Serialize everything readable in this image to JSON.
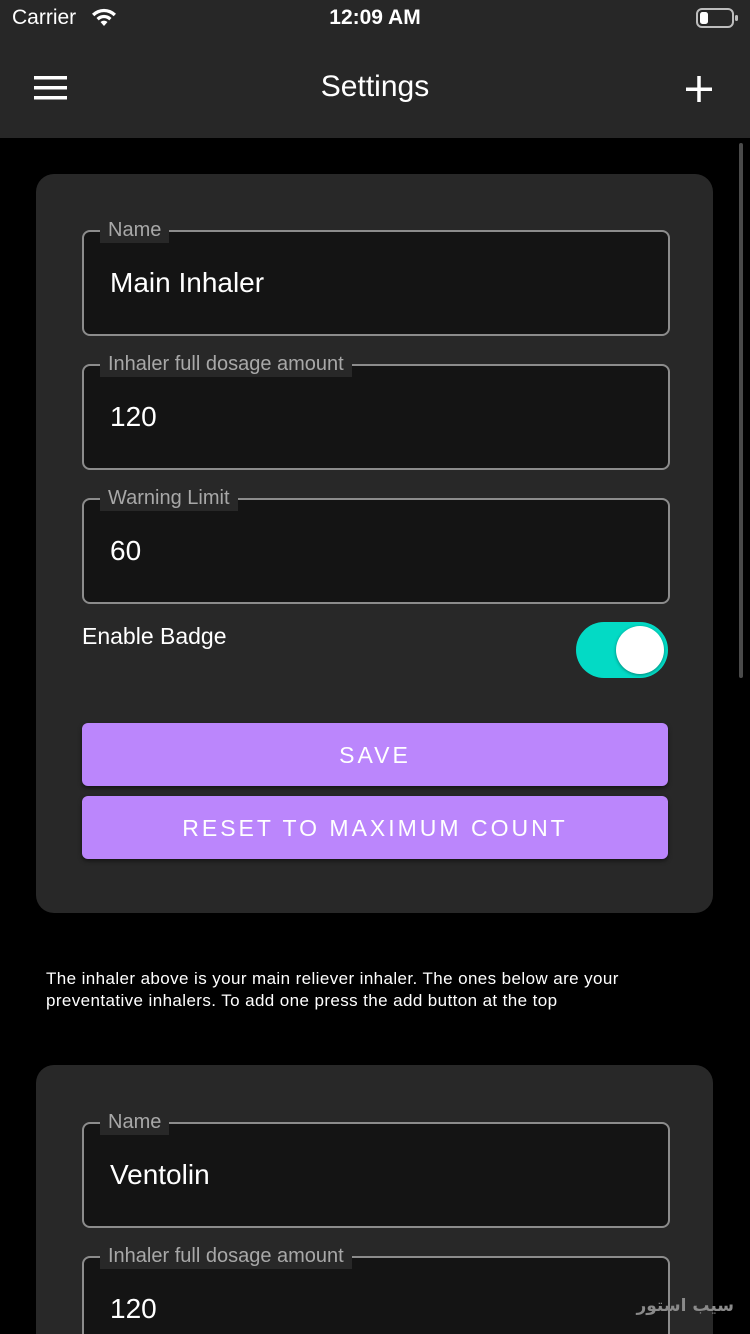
{
  "status_bar": {
    "carrier": "Carrier",
    "time": "12:09 AM"
  },
  "nav": {
    "title": "Settings",
    "menu_icon": "hamburger-menu-icon",
    "add_icon": "plus-icon"
  },
  "main_inhaler": {
    "name_label": "Name",
    "name_value": "Main Inhaler",
    "dosage_label": "Inhaler full dosage amount",
    "dosage_value": "120",
    "warning_label": "Warning Limit",
    "warning_value": "60",
    "badge_label": "Enable Badge",
    "badge_enabled": true,
    "save_label": "SAVE",
    "reset_label": "RESET TO MAXIMUM COUNT"
  },
  "info_text": "The inhaler above is your main reliever inhaler. The ones below are your preventative inhalers. To add one press the add button at the top",
  "second_inhaler": {
    "name_label": "Name",
    "name_value": "Ventolin",
    "dosage_label": "Inhaler full dosage amount",
    "dosage_value": "120"
  },
  "watermark": "سیب استور",
  "colors": {
    "bar_background": "#272727",
    "card_background": "#282828",
    "page_background": "#000000",
    "accent_purple": "#bb86fc",
    "toggle_teal": "#03dac5"
  }
}
